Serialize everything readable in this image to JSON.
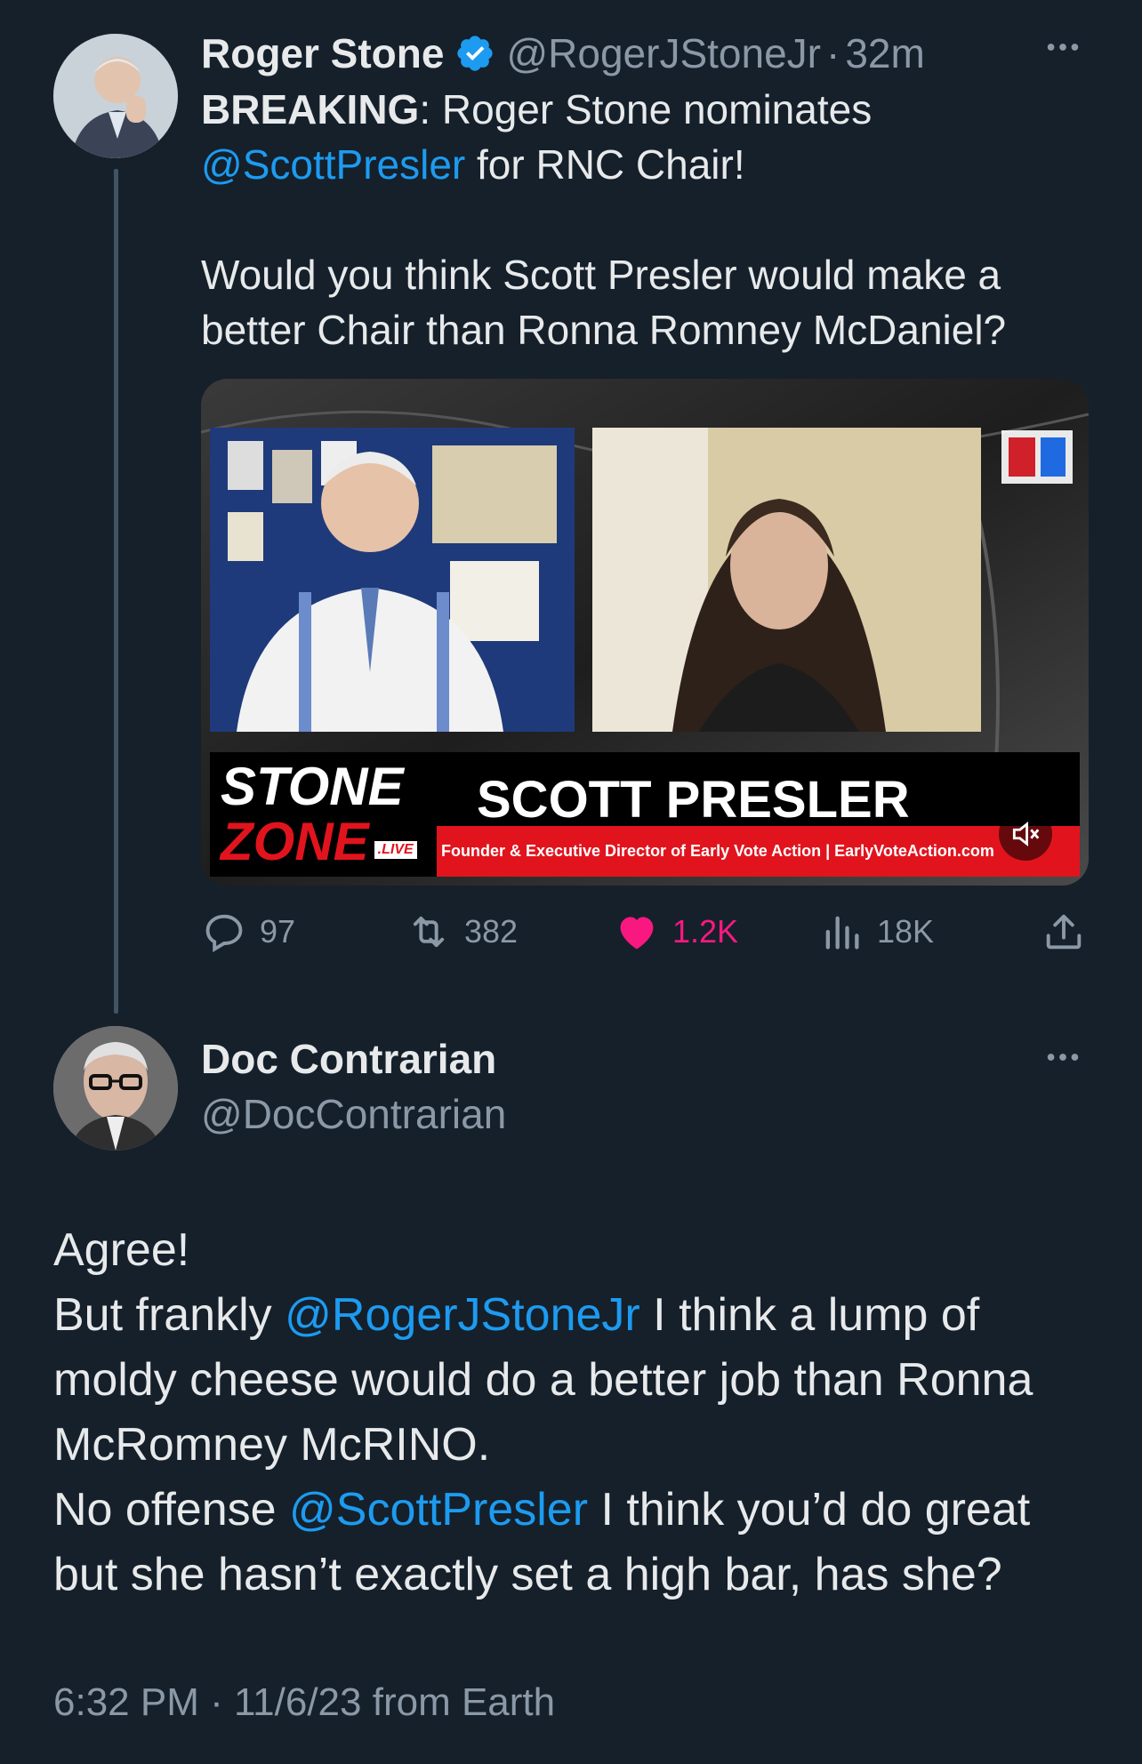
{
  "tweet": {
    "author_name": "Roger Stone",
    "author_handle": "@RogerJStoneJr",
    "separator": "·",
    "time": "32m",
    "more_icon": "more-horizontal-icon",
    "text": {
      "breaking": "BREAKING",
      "line1_rest": ": Roger Stone nominates",
      "mention": "@ScottPresler",
      "line2_rest": " for RNC Chair!",
      "para2_line1": "Would you think Scott Presler would make a",
      "para2_line2": "better Chair than Ronna Romney McDaniel?"
    },
    "media": {
      "show_logo_line1": "STONE",
      "show_logo_line2": "ZONE",
      "live_badge": ".LIVE",
      "guest_name": "SCOTT PRESLER",
      "guest_title": "Founder & Executive Director of Early Vote Action | EarlyVoteAction.com",
      "mute_icon": "volume-muted-icon"
    },
    "actions": {
      "replies": "97",
      "retweets": "382",
      "likes": "1.2K",
      "views": "18K"
    }
  },
  "reply": {
    "author_name": "Doc Contrarian",
    "author_handle": "@DocContrarian",
    "line1": "Agree!",
    "line2_a": "But frankly ",
    "mention1": "@RogerJStoneJr",
    "line2_b": " I think a lump of",
    "line3": "moldy cheese would do a better job than Ronna",
    "line4": "McRomney McRINO.",
    "line5_a": "No offense ",
    "mention2": "@ScottPresler",
    "line5_b": " I think you’d do great",
    "line6": "but she hasn’t exactly set a high bar, has she?",
    "timestamp": "6:32 PM · 11/6/23 from Earth"
  },
  "colors": {
    "background": "#15202b",
    "accent": "#1d9bf0",
    "like": "#f91880",
    "secondary_text": "#8b98a5"
  }
}
